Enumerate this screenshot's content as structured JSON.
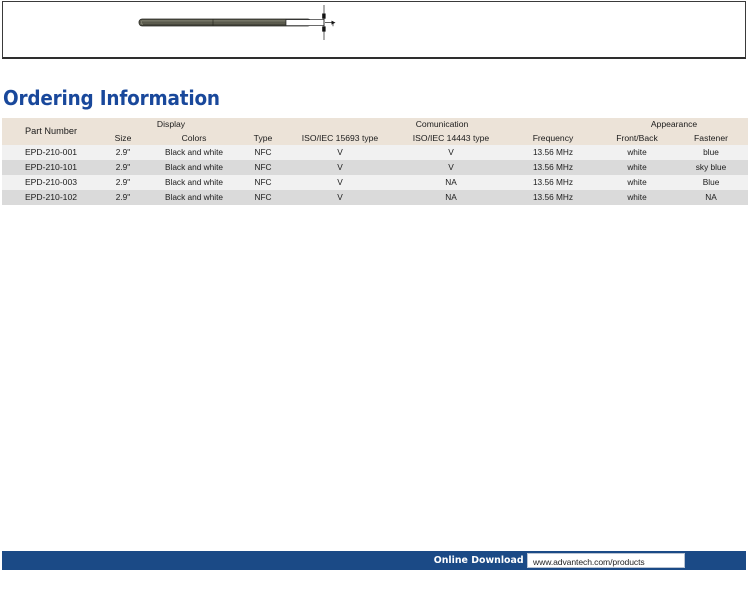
{
  "drawing": {
    "name": "side-view-panel-thickness-drawing",
    "description": "Side profile technical drawing of thin e-paper display panel with thickness dimension arrow"
  },
  "section": {
    "heading": "Ordering Information"
  },
  "table": {
    "group_headers": [
      {
        "label": "Part Number",
        "span": 1
      },
      {
        "label": "Display",
        "span": 2
      },
      {
        "label": "",
        "span": 1
      },
      {
        "label": "Comunication",
        "span": 3
      },
      {
        "label": "Appearance",
        "span": 2
      }
    ],
    "sub_headers": [
      "",
      "Size",
      "Colors",
      "Type",
      "ISO/IEC 15693 type",
      "ISO/IEC 14443 type",
      "Frequency",
      "Front/Back",
      "Fastener"
    ],
    "rows": [
      {
        "part_number": "EPD-210-001",
        "size": "2.9\"",
        "colors": "Black and white",
        "type": "NFC",
        "iso_15693": "V",
        "iso_14443": "V",
        "frequency": "13.56 MHz",
        "front_back": "white",
        "fastener": "blue"
      },
      {
        "part_number": "EPD-210-101",
        "size": "2.9\"",
        "colors": "Black and white",
        "type": "NFC",
        "iso_15693": "V",
        "iso_14443": "V",
        "frequency": "13.56 MHz",
        "front_back": "white",
        "fastener": "sky blue"
      },
      {
        "part_number": "EPD-210-003",
        "size": "2.9\"",
        "colors": "Black and white",
        "type": "NFC",
        "iso_15693": "V",
        "iso_14443": "NA",
        "frequency": "13.56 MHz",
        "front_back": "white",
        "fastener": "Blue"
      },
      {
        "part_number": "EPD-210-102",
        "size": "2.9\"",
        "colors": "Black and white",
        "type": "NFC",
        "iso_15693": "V",
        "iso_14443": "NA",
        "frequency": "13.56 MHz",
        "front_back": "white",
        "fastener": "NA"
      }
    ]
  },
  "footer": {
    "label": "Online Download",
    "url": "www.advantech.com/products"
  },
  "colors": {
    "heading_blue": "#19489b",
    "footer_blue": "#1b4a86",
    "header_beige": "#ece3d8",
    "row_light": "#f1f1f1",
    "row_dark": "#dadada"
  }
}
